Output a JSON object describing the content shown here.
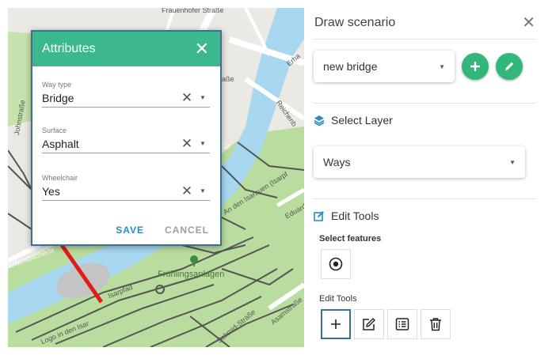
{
  "map": {
    "street_labels": [
      "Frauenhofer Straße",
      "Erha",
      "aße",
      "Reichenb",
      "ar",
      "Eduard",
      "Schmid-Straße",
      "Asamstraße",
      "An den Isarauen (Isarpf",
      "Wittelsbacherbr",
      "Frühlingsanlagen",
      "Logo in den Isar",
      "Isarpfad"
    ],
    "park_label": "Frühlingsanlagen",
    "left_street_label": "Johnstraße",
    "colors": {
      "water": "#a8d7f0",
      "park": "#b9dd9e",
      "road": "#ffffff",
      "path": "#555555",
      "bridge": "#e31a1a",
      "land": "#eae9e4"
    }
  },
  "dialog": {
    "title": "Attributes",
    "fields": [
      {
        "label": "Way type",
        "value": "Bridge"
      },
      {
        "label": "Surface",
        "value": "Asphalt"
      },
      {
        "label": "Wheelchair",
        "value": "Yes"
      }
    ],
    "save_label": "SAVE",
    "cancel_label": "CANCEL",
    "colors": {
      "header": "#3cb88f",
      "save": "#2b8cc4"
    }
  },
  "panel": {
    "title": "Draw scenario",
    "scenario_select": "new bridge",
    "select_layer_heading": "Select Layer",
    "layer_select": "Ways",
    "edit_tools_heading": "Edit Tools",
    "select_features_label": "Select features",
    "edit_tools_label": "Edit Tools",
    "colors": {
      "accent_green": "#33b67a",
      "heading_icon": "#2b8cc4"
    },
    "icons": [
      "plus-icon",
      "pencil-icon",
      "layers-icon",
      "edit-square-icon",
      "radio-target-icon",
      "add-icon",
      "edit-icon",
      "list-icon",
      "delete-icon"
    ]
  }
}
